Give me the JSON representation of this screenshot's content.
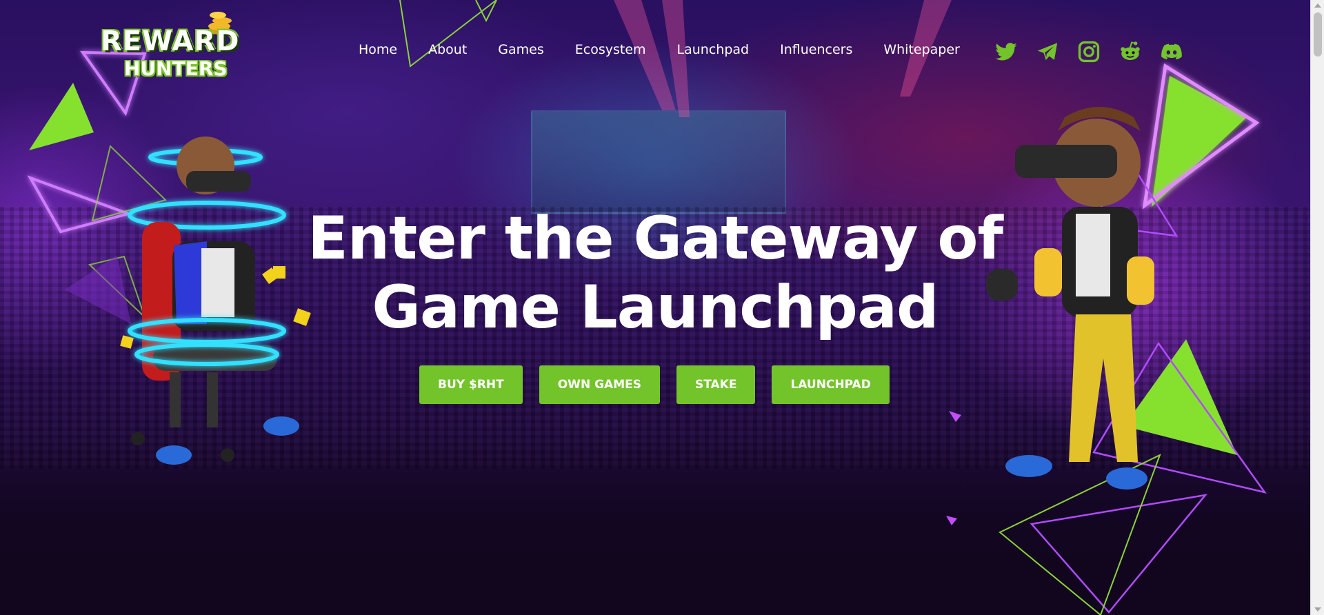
{
  "logo": {
    "line1": "REWARD",
    "line2": "HUNTERS"
  },
  "nav": {
    "items": [
      {
        "label": "Home"
      },
      {
        "label": "About"
      },
      {
        "label": "Games"
      },
      {
        "label": "Ecosystem"
      },
      {
        "label": "Launchpad"
      },
      {
        "label": "Influencers"
      },
      {
        "label": "Whitepaper"
      }
    ]
  },
  "social": {
    "icons": [
      "twitter-icon",
      "telegram-icon",
      "instagram-icon",
      "reddit-icon",
      "discord-icon"
    ],
    "color": "#73c42a"
  },
  "hero": {
    "headline_line1": "Enter the Gateway of",
    "headline_line2": "Game Launchpad"
  },
  "cta": {
    "buttons": [
      {
        "label": "BUY $RHT"
      },
      {
        "label": "OWN GAMES"
      },
      {
        "label": "STAKE"
      },
      {
        "label": "LAUNCHPAD"
      }
    ],
    "color": "#73c42a"
  },
  "theme": {
    "accent_green": "#86e02e",
    "neon_purple": "#c34dff",
    "background": "#1a0a33"
  }
}
